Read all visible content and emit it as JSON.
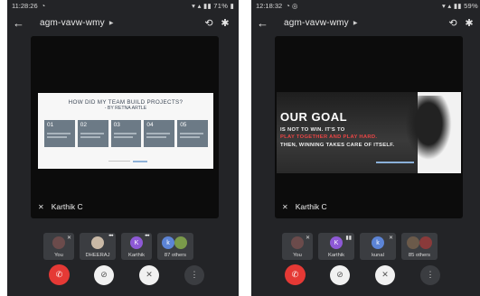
{
  "colors": {
    "hangup": "#e53935",
    "purple_avatar": "#8e59d6",
    "blue_avatar": "#5c84d6",
    "card": "#6c7a86"
  },
  "icons": {
    "back": "arrow-left-icon",
    "switch_camera": "switch-camera-icon",
    "bluetooth": "bluetooth-icon",
    "mic_off": "mic-off-icon",
    "hangup": "call-end-icon",
    "camera_off": "camera-off-icon",
    "more": "more-vert-icon"
  },
  "left": {
    "status": {
      "time": "11:28:26",
      "right": "71%"
    },
    "meeting_code": "agm-vavw-wmy",
    "slide": {
      "title": "HOW DID MY TEAM BUILD PROJECTS?",
      "subtitle": "- BY RETNA ARTLE",
      "cards": [
        "01",
        "02",
        "03",
        "04",
        "05"
      ]
    },
    "speaker": "Karthik C",
    "tiles": [
      {
        "label": "You",
        "avatar": ""
      },
      {
        "label": "DHEERAJ",
        "avatar": ""
      },
      {
        "label": "Karthik",
        "avatar": "K"
      },
      {
        "label": "87 others",
        "avatar": "k"
      }
    ]
  },
  "right": {
    "status": {
      "time": "12:18:32",
      "right": "59%"
    },
    "meeting_code": "agm-vavw-wmy",
    "poster": {
      "headline": "OUR GOAL",
      "line1": "IS NOT TO WIN. IT'S TO",
      "line2_red": "PLAY TOGETHER AND PLAY HARD.",
      "line3": "THEN, WINNING TAKES CARE OF ITSELF."
    },
    "speaker": "Karthik C",
    "tiles": [
      {
        "label": "You",
        "avatar": ""
      },
      {
        "label": "Karthik",
        "avatar": "K"
      },
      {
        "label": "kunal",
        "avatar": "k"
      },
      {
        "label": "85 others",
        "avatar": ""
      }
    ]
  }
}
